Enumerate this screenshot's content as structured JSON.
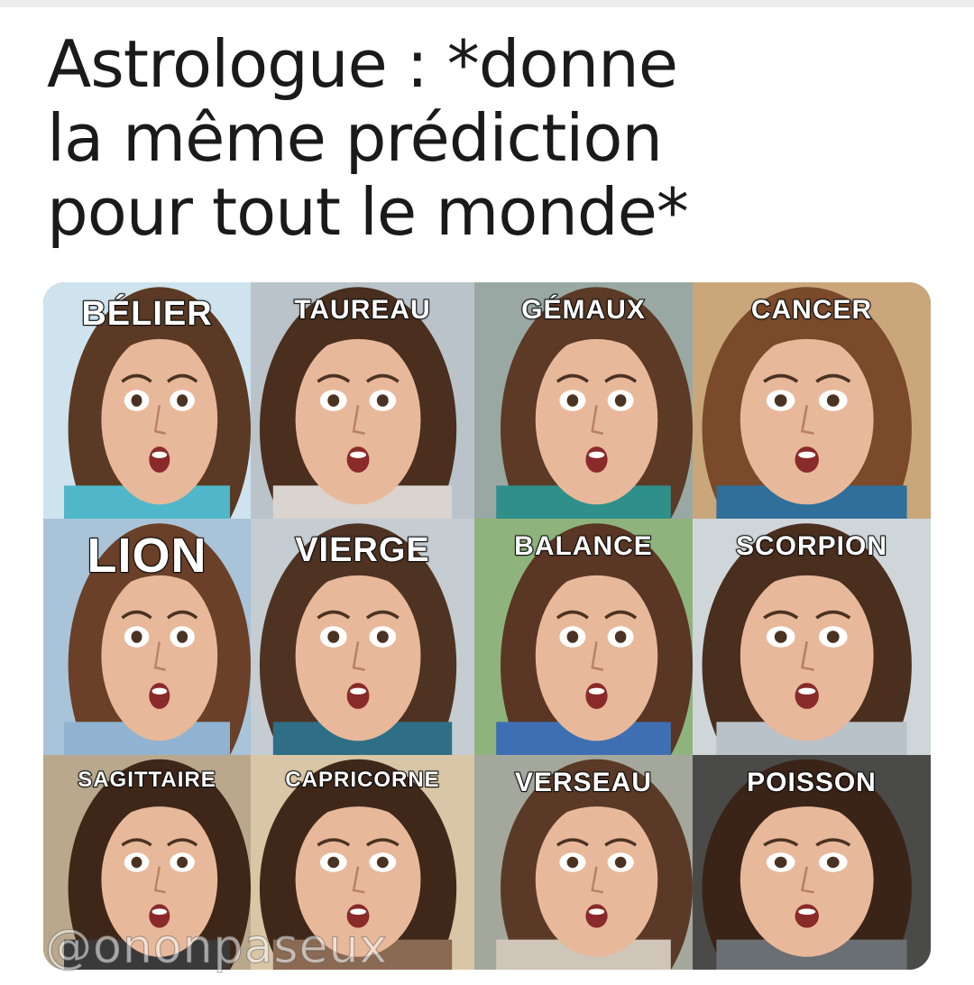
{
  "caption": {
    "line1": "Astrologue : *donne",
    "line2": "la même prédiction",
    "line3": "pour tout le monde*"
  },
  "signs": [
    {
      "label": "BÉLIER",
      "bg": "#cfe3ee",
      "hair": "#5a3a24",
      "accent": "#4fb7c9"
    },
    {
      "label": "TAUREAU",
      "bg": "#b9c3c9",
      "hair": "#4a2e1e",
      "accent": "#d9d4cf"
    },
    {
      "label": "GÉMAUX",
      "bg": "#9aa8a4",
      "hair": "#5c3a26",
      "accent": "#2f8f8a"
    },
    {
      "label": "CANCER",
      "bg": "#c9a77a",
      "hair": "#7a4a2a",
      "accent": "#2f6f9a"
    },
    {
      "label": "LION",
      "bg": "#a9c4d8",
      "hair": "#6a4028",
      "accent": "#8fb3d1"
    },
    {
      "label": "VIERGE",
      "bg": "#c5cdd3",
      "hair": "#4f3322",
      "accent": "#2e6f86"
    },
    {
      "label": "BALANCE",
      "bg": "#8fb37c",
      "hair": "#5a3624",
      "accent": "#3f6fb3"
    },
    {
      "label": "SCORPION",
      "bg": "#cfd6da",
      "hair": "#4a2e1e",
      "accent": "#b9c2c8"
    },
    {
      "label": "SAGITTAIRE",
      "bg": "#b9a88c",
      "hair": "#3e2718",
      "accent": "#3a3a3a"
    },
    {
      "label": "CAPRICORNE",
      "bg": "#d8c6a6",
      "hair": "#3f2819",
      "accent": "#8a6a52"
    },
    {
      "label": "VERSEAU",
      "bg": "#a4a89c",
      "hair": "#5a3a26",
      "accent": "#cfc5b8"
    },
    {
      "label": "POISSON",
      "bg": "#4a4a48",
      "hair": "#3a2418",
      "accent": "#6a6f74"
    }
  ],
  "watermark": "@ononpaseux",
  "colors": {
    "skin": "#e8b89a",
    "mouth": "#8a2a2a",
    "text_fill": "#ffffff",
    "text_stroke": "#1a1a1a"
  }
}
